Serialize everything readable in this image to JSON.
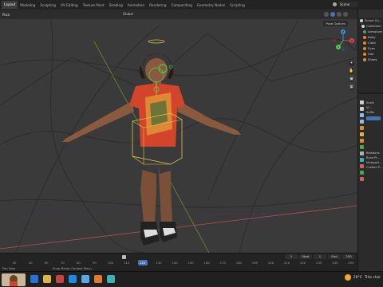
{
  "workspace_tabs": [
    "Layout",
    "Modeling",
    "Sculpting",
    "UV Editing",
    "Texture Paint",
    "Shading",
    "Animation",
    "Rendering",
    "Compositing",
    "Geometry Nodes",
    "Scripting"
  ],
  "active_tab": "Layout",
  "scene_field": "Scene",
  "viewport": {
    "mode": "Pose",
    "orientation": "Global",
    "overlay_label": "Pose Options"
  },
  "nav_gizmo": {
    "x_label": "X",
    "y_label": "Y",
    "z_label": "Z"
  },
  "viewport_tools": [
    "+",
    "hand",
    "cam",
    "grid"
  ],
  "outliner": {
    "rows": [
      "Scene Co...",
      "Collection",
      "Armature",
      "Body",
      "Cloth",
      "Eyes",
      "Hair",
      "Shoes"
    ],
    "dot_colors": [
      "#cfcfcf",
      "#cfcfcf",
      "#4aa84a",
      "#e08a2c",
      "#e08a2c",
      "#e08a2c",
      "#e08a2c",
      "#e08a2c"
    ]
  },
  "properties": {
    "tab_colors": [
      "#cfcfcf",
      "#cfcfcf",
      "#8fb9e8",
      "#8fb9e8",
      "#e08a2c",
      "#e0b24a",
      "#e08a2c",
      "#4aa84a",
      "#b0b0b0",
      "#3fb0b0",
      "#d06060",
      "#4aa84a",
      "#d06060"
    ],
    "lines": [
      "Scale",
      "Vi...",
      "Suffix",
      "",
      "",
      "",
      "",
      "",
      "",
      "Relations",
      "Bone Pr...",
      "Viewport...",
      "Custom P..."
    ]
  },
  "timeline": {
    "ticks": [
      "40",
      "50",
      "60",
      "70",
      "80",
      "90",
      "100",
      "110",
      "120",
      "130",
      "140",
      "150",
      "160",
      "170",
      "180",
      "190",
      "200",
      "210",
      "220",
      "230",
      "240",
      "250"
    ],
    "current_frame": "120",
    "start_label": "Start",
    "start_value": "1",
    "end_label": "End",
    "end_value": "250",
    "frame_field": "1",
    "status_left": "Pan View",
    "status_mid": "Snap Motion Context Menu"
  },
  "taskbar": {
    "app_colors": [
      "#2a6fd6",
      "#e0b24a",
      "#c74242",
      "#1e88e5",
      "#5aa7e8",
      "#e07a2c",
      "#3fb0b0"
    ],
    "weather": "28°C",
    "weather_desc": "Très clair"
  }
}
